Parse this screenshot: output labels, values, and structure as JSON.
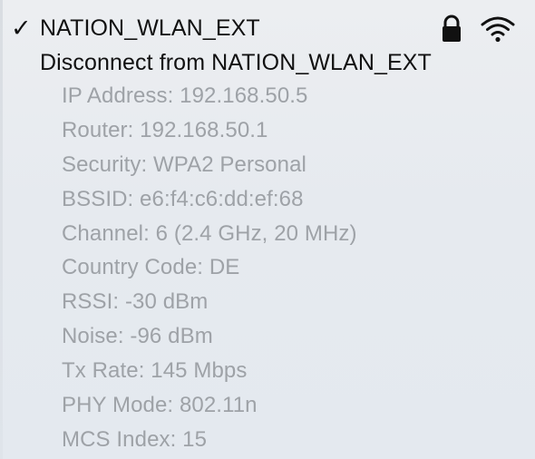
{
  "network": {
    "check_glyph": "✓",
    "name": "NATION_WLAN_EXT",
    "lock_icon": "lock-icon",
    "wifi_icon": "wifi-icon",
    "disconnect_label": "Disconnect from NATION_WLAN_EXT"
  },
  "details": [
    "IP Address: 192.168.50.5",
    "Router: 192.168.50.1",
    "Security: WPA2 Personal",
    "BSSID: e6:f4:c6:dd:ef:68",
    "Channel: 6 (2.4 GHz, 20 MHz)",
    "Country Code: DE",
    "RSSI: -30 dBm",
    "Noise: -96 dBm",
    "Tx Rate: 145 Mbps",
    "PHY Mode: 802.11n",
    "MCS Index: 15"
  ],
  "colors": {
    "primary_text": "#111111",
    "secondary_text": "#9ea2a7",
    "menu_background": "#e6eaef"
  }
}
